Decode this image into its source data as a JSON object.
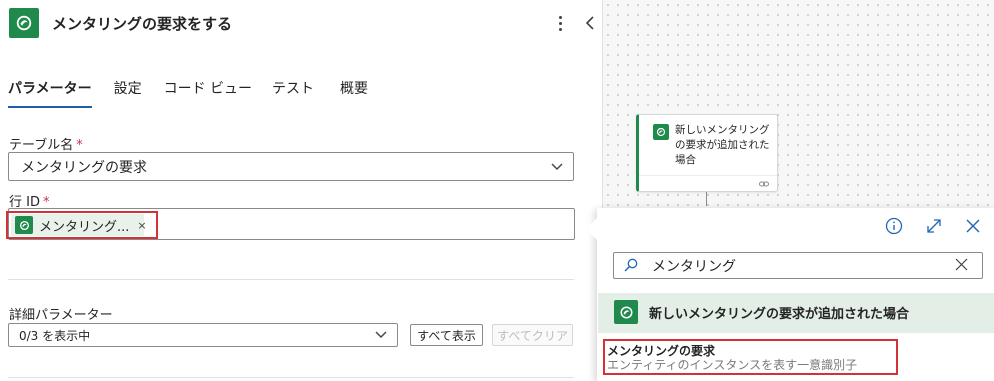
{
  "header": {
    "title": "メンタリングの要求をする"
  },
  "tabs": [
    {
      "label": "パラメーター"
    },
    {
      "label": "設定"
    },
    {
      "label": "コード ビュー"
    },
    {
      "label": "テスト"
    },
    {
      "label": "概要"
    }
  ],
  "table_field": {
    "label": "テーブル名",
    "required_mark": "*",
    "value": "メンタリングの要求"
  },
  "row_id_field": {
    "label": "行 ID",
    "required_mark": "*",
    "token_text": "メンタリング...",
    "token_remove": "×"
  },
  "advanced": {
    "label": "詳細パラメーター",
    "select_value": "0/3 を表示中",
    "show_all": "すべて表示",
    "clear_all": "すべてクリア"
  },
  "canvas": {
    "trigger_card_text": "新しいメンタリングの要求が追加された場合"
  },
  "popup": {
    "search_value": "メンタリング",
    "result_group_title": "新しいメンタリングの要求が追加された場合",
    "item_title": "メンタリングの要求",
    "item_description": "エンティティのインスタンスを表す一意識別子"
  },
  "colors": {
    "brand_green": "#1f8a4c",
    "tab_underline": "#1f5fa8",
    "highlight_red": "#d13438",
    "accent_blue": "#2266b5"
  }
}
